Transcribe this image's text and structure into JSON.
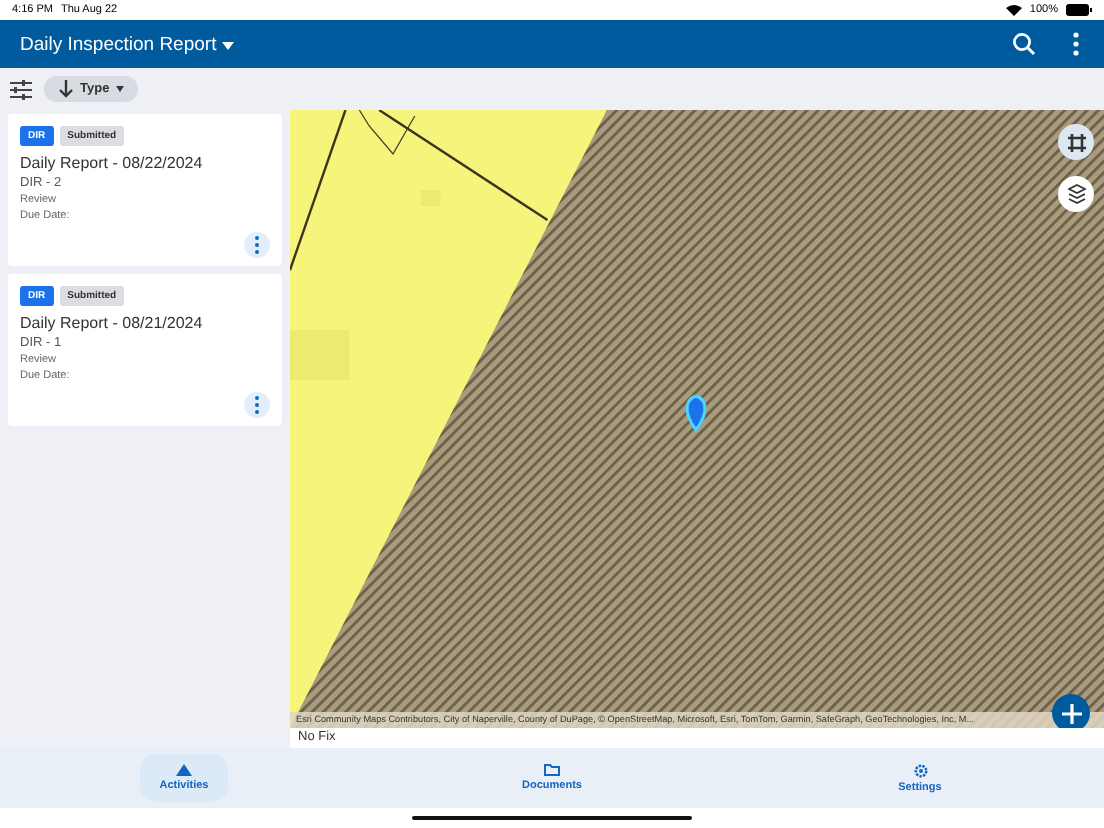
{
  "status_bar": {
    "time": "4:16 PM",
    "date": "Thu Aug 22",
    "battery": "100%"
  },
  "header": {
    "title": "Daily Inspection Report"
  },
  "toolbar": {
    "sort_label": "Type"
  },
  "reports": [
    {
      "type": "DIR",
      "status": "Submitted",
      "title": "Daily Report - 08/22/2024",
      "id": "DIR - 2",
      "stage": "Review",
      "due": "Due Date:"
    },
    {
      "type": "DIR",
      "status": "Submitted",
      "title": "Daily Report - 08/21/2024",
      "id": "DIR - 1",
      "stage": "Review",
      "due": "Due Date:"
    }
  ],
  "map": {
    "attribution": "Esri Community Maps Contributors, City of Naperville, County of DuPage, © OpenStreetMap, Microsoft, Esri, TomTom, Garmin, SafeGraph, GeoTechnologies, Inc, M...",
    "gps_status": "No Fix"
  },
  "nav": [
    {
      "label": "Activities",
      "selected": true
    },
    {
      "label": "Documents",
      "selected": false
    },
    {
      "label": "Settings",
      "selected": false
    }
  ]
}
